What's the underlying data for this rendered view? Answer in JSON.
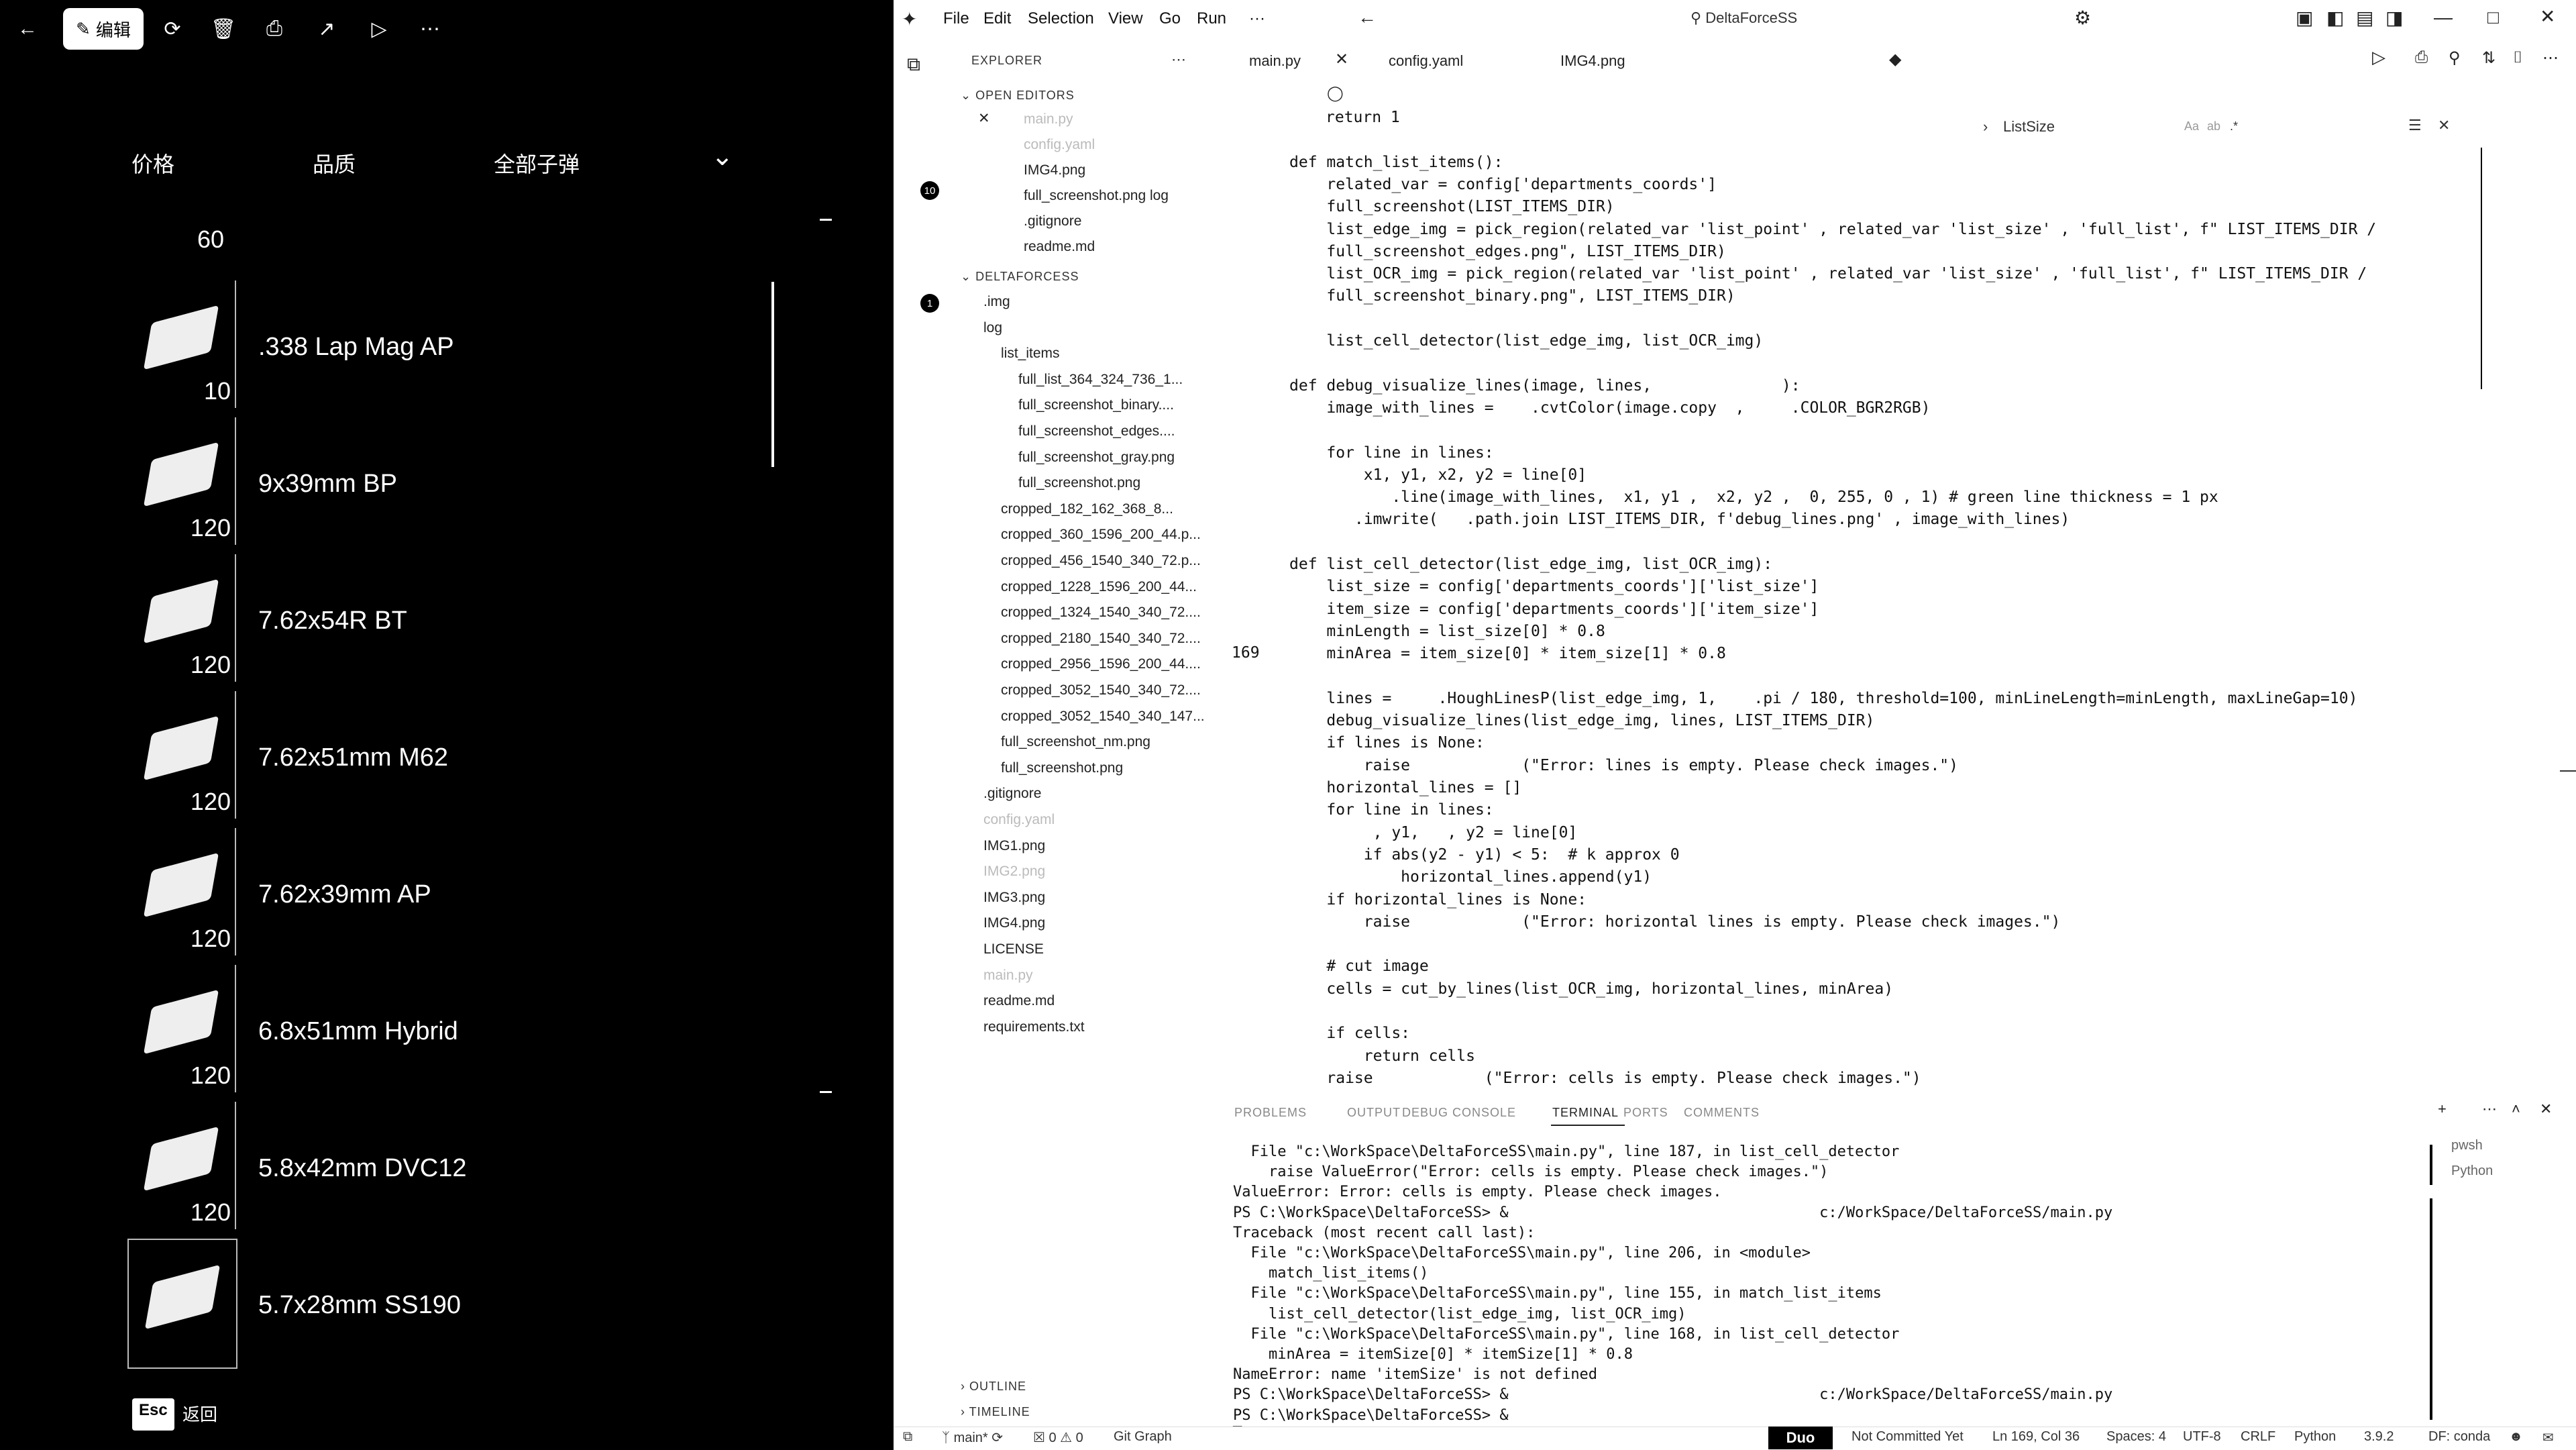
{
  "viewer": {
    "toolbar": {
      "back_icon": "arrow-left-icon",
      "edit_label": "编辑",
      "icons": [
        "rotate-icon",
        "trash-icon",
        "print-icon",
        "share-icon",
        "slideshow-icon",
        "more-icon"
      ]
    },
    "filters": {
      "price": "价格",
      "quality": "品质",
      "all": "全部子弹"
    },
    "top_qty": "60",
    "ammo_list": [
      {
        "name": ".338 Lap Mag AP",
        "qty": "10"
      },
      {
        "name": "9x39mm BP",
        "qty": "120"
      },
      {
        "name": "7.62x54R BT",
        "qty": "120"
      },
      {
        "name": "7.62x51mm M62",
        "qty": "120"
      },
      {
        "name": "7.62x39mm AP",
        "qty": "120"
      },
      {
        "name": "6.8x51mm Hybrid",
        "qty": "120"
      },
      {
        "name": "5.8x42mm DVC12",
        "qty": "120"
      },
      {
        "name": "5.7x28mm SS190",
        "qty": ""
      }
    ],
    "esc_label": "Esc",
    "back_label": "返回"
  },
  "vscode": {
    "menu": [
      "File",
      "Edit",
      "Selection",
      "View",
      "Go",
      "Run",
      "···"
    ],
    "search_text": "DeltaForceSS",
    "explorer_title": "EXPLORER",
    "open_editors_title": "OPEN EDITORS",
    "open_editors_badge": "10",
    "open_editors": [
      "main.py",
      "config.yaml",
      "IMG4.png",
      "full_screenshot.png log",
      ".gitignore",
      "readme.md"
    ],
    "workspace_title": "DELTAFORCESS",
    "workspace_badge": "1",
    "tree": [
      {
        "label": ".img",
        "indent": 1
      },
      {
        "label": "log",
        "indent": 1
      },
      {
        "label": "list_items",
        "indent": 2
      },
      {
        "label": "full_list_364_324_736_1...",
        "indent": 3
      },
      {
        "label": "full_screenshot_binary....",
        "indent": 3
      },
      {
        "label": "full_screenshot_edges....",
        "indent": 3
      },
      {
        "label": "full_screenshot_gray.png",
        "indent": 3
      },
      {
        "label": "full_screenshot.png",
        "indent": 3
      },
      {
        "label": "cropped_182_162_368_8...",
        "indent": 2
      },
      {
        "label": "cropped_360_1596_200_44.p...",
        "indent": 2
      },
      {
        "label": "cropped_456_1540_340_72.p...",
        "indent": 2
      },
      {
        "label": "cropped_1228_1596_200_44...",
        "indent": 2
      },
      {
        "label": "cropped_1324_1540_340_72....",
        "indent": 2
      },
      {
        "label": "cropped_2180_1540_340_72....",
        "indent": 2
      },
      {
        "label": "cropped_2956_1596_200_44....",
        "indent": 2
      },
      {
        "label": "cropped_3052_1540_340_72....",
        "indent": 2
      },
      {
        "label": "cropped_3052_1540_340_147...",
        "indent": 2
      },
      {
        "label": "full_screenshot_nm.png",
        "indent": 2
      },
      {
        "label": "full_screenshot.png",
        "indent": 2
      },
      {
        "label": ".gitignore",
        "indent": 1
      },
      {
        "label": "config.yaml",
        "indent": 1
      },
      {
        "label": "IMG1.png",
        "indent": 1
      },
      {
        "label": "IMG2.png",
        "indent": 1
      },
      {
        "label": "IMG3.png",
        "indent": 1
      },
      {
        "label": "IMG4.png",
        "indent": 1
      },
      {
        "label": "LICENSE",
        "indent": 1
      },
      {
        "label": "main.py",
        "indent": 1
      },
      {
        "label": "readme.md",
        "indent": 1
      },
      {
        "label": "requirements.txt",
        "indent": 1
      }
    ],
    "outline_title": "OUTLINE",
    "timeline_title": "TIMELINE",
    "tabs": [
      "main.py",
      "config.yaml",
      "IMG4.png"
    ],
    "find_widget": "ListSize",
    "code": [
      "return 1",
      "",
      "def match_list_items():",
      "    related_var = config['departments_coords']",
      "    full_screenshot(LIST_ITEMS_DIR)",
      "    list_edge_img = pick_region(related_var 'list_point' , related_var 'list_size' , 'full_list', f\" LIST_ITEMS_DIR /",
      "    full_screenshot_edges.png\", LIST_ITEMS_DIR)",
      "    list_OCR_img = pick_region(related_var 'list_point' , related_var 'list_size' , 'full_list', f\" LIST_ITEMS_DIR /",
      "    full_screenshot_binary.png\", LIST_ITEMS_DIR)",
      "",
      "    list_cell_detector(list_edge_img, list_OCR_img)",
      "",
      "def debug_visualize_lines(image, lines,              ):",
      "    image_with_lines =    .cvtColor(image.copy  ,     .COLOR_BGR2RGB)",
      "",
      "    for line in lines:",
      "        x1, y1, x2, y2 = line[0]",
      "           .line(image_with_lines,  x1, y1 ,  x2, y2 ,  0, 255, 0 , 1) # green line thickness = 1 px",
      "       .imwrite(   .path.join LIST_ITEMS_DIR, f'debug_lines.png' , image_with_lines)",
      "",
      "def list_cell_detector(list_edge_img, list_OCR_img):",
      "    list_size = config['departments_coords']['list_size']",
      "    item_size = config['departments_coords']['item_size']",
      "    minLength = list_size[0] * 0.8",
      "    minArea = item_size[0] * item_size[1] * 0.8",
      "",
      "    lines =     .HoughLinesP(list_edge_img, 1,    .pi / 180, threshold=100, minLineLength=minLength, maxLineGap=10)",
      "    debug_visualize_lines(list_edge_img, lines, LIST_ITEMS_DIR)",
      "    if lines is None:",
      "        raise            (\"Error: lines is empty. Please check images.\")",
      "    horizontal_lines = []",
      "    for line in lines:",
      "         , y1,   , y2 = line[0]",
      "        if abs(y2 - y1) < 5:  # k approx 0",
      "            horizontal_lines.append(y1)",
      "    if horizontal_lines is None:",
      "        raise            (\"Error: horizontal lines is empty. Please check images.\")",
      "",
      "    # cut image",
      "    cells = cut_by_lines(list_OCR_img, horizontal_lines, minArea)",
      "",
      "    if cells:",
      "        return cells",
      "    raise            (\"Error: cells is empty. Please check images.\")"
    ],
    "current_line_number": "169",
    "terminal_tabs": [
      "PROBLEMS",
      "OUTPUT",
      "DEBUG CONSOLE",
      "TERMINAL",
      "PORTS",
      "COMMENTS"
    ],
    "terminal_sessions": [
      "pwsh",
      "Python"
    ],
    "terminal": [
      "  File \"c:\\WorkSpace\\DeltaForceSS\\main.py\", line 187, in list_cell_detector",
      "    raise ValueError(\"Error: cells is empty. Please check images.\")",
      "ValueError: Error: cells is empty. Please check images.",
      "PS C:\\WorkSpace\\DeltaForceSS> &                                   c:/WorkSpace/DeltaForceSS/main.py",
      "Traceback (most recent call last):",
      "  File \"c:\\WorkSpace\\DeltaForceSS\\main.py\", line 206, in <module>",
      "    match_list_items()",
      "  File \"c:\\WorkSpace\\DeltaForceSS\\main.py\", line 155, in match_list_items",
      "    list_cell_detector(list_edge_img, list_OCR_img)",
      "  File \"c:\\WorkSpace\\DeltaForceSS\\main.py\", line 168, in list_cell_detector",
      "    minArea = itemSize[0] * itemSize[1] * 0.8",
      "NameError: name 'itemSize' is not defined",
      "PS C:\\WorkSpace\\DeltaForceSS> &                                   c:/WorkSpace/DeltaForceSS/main.py",
      "PS C:\\WorkSpace\\DeltaForceSS> &",
      "█"
    ],
    "status": {
      "branch": "main*",
      "errors": "0 ⚠ 0",
      "graph": "Git Graph",
      "duo": "Duo",
      "commit": "Not Committed Yet",
      "position": "Ln 169, Col 36",
      "spaces": "Spaces: 4",
      "encoding": "UTF-8",
      "eol": "CRLF",
      "language": "Python",
      "version": "3.9.2",
      "env": "DF: conda"
    }
  }
}
